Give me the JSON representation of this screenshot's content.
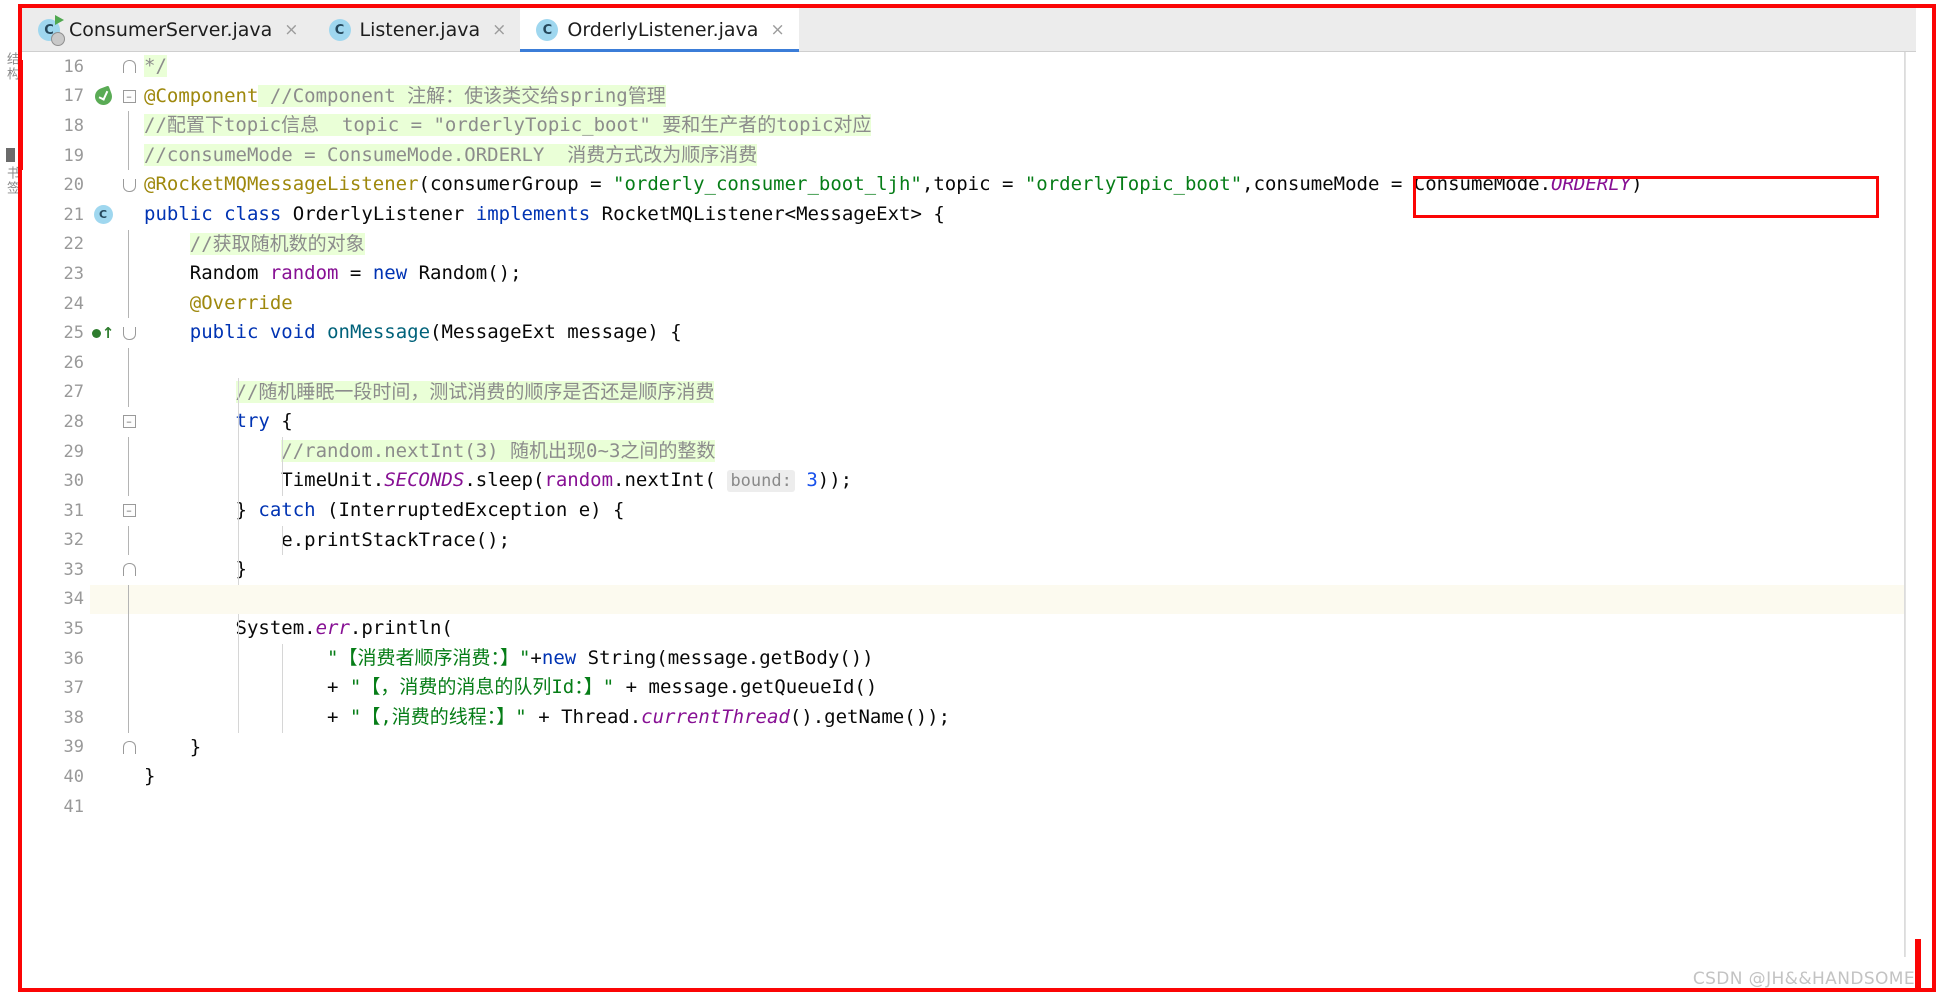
{
  "window": {
    "app": "IntelliJ IDEA Editor",
    "watermark": "CSDN @JH&&HANDSOME"
  },
  "tabs": [
    {
      "label": "ConsumerServer.java",
      "icon": "java-class-run-icon",
      "close": "×",
      "active": false,
      "badge": "C"
    },
    {
      "label": "Listener.java",
      "icon": "java-class-icon",
      "close": "×",
      "active": false,
      "badge": "C"
    },
    {
      "label": "OrderlyListener.java",
      "icon": "java-class-icon",
      "close": "×",
      "active": true,
      "badge": "C"
    }
  ],
  "left_stripe": {
    "labels": [
      "结构",
      "书签"
    ]
  },
  "annotation": {
    "box_color": "#fb0505",
    "frame_color": "#fb0505"
  },
  "editor": {
    "language": "Java",
    "file": "OrderlyListener.java",
    "first_visible_line": 16,
    "last_visible_line": 41,
    "highlighted_line": 34,
    "lines": [
      {
        "num": "16",
        "gutter_icon": "",
        "fold": "",
        "text": "*/"
      },
      {
        "num": "17",
        "gutter_icon": "spring-bean-icon",
        "fold": "fold-collapse",
        "text": "@Component //Component 注解：使该类交给spring管理"
      },
      {
        "num": "18",
        "gutter_icon": "",
        "fold": "",
        "text": "//配置下topic信息  topic = \"orderlyTopic_boot\" 要和生产者的topic对应"
      },
      {
        "num": "19",
        "gutter_icon": "",
        "fold": "",
        "text": "//consumeMode = ConsumeMode.ORDERLY  消费方式改为顺序消费"
      },
      {
        "num": "20",
        "gutter_icon": "",
        "fold": "fold-start",
        "text": "@RocketMQMessageListener(consumerGroup = \"orderly_consumer_boot_ljh\",topic = \"orderlyTopic_boot\",consumeMode = ConsumeMode.ORDERLY)"
      },
      {
        "num": "21",
        "gutter_icon": "java-class-icon",
        "fold": "",
        "text": "public class OrderlyListener implements RocketMQListener<MessageExt> {"
      },
      {
        "num": "22",
        "gutter_icon": "",
        "fold": "",
        "text": "//获取随机数的对象"
      },
      {
        "num": "23",
        "gutter_icon": "",
        "fold": "",
        "text": "Random random = new Random();"
      },
      {
        "num": "24",
        "gutter_icon": "",
        "fold": "",
        "text": "@Override"
      },
      {
        "num": "25",
        "gutter_icon": "override-method-icon",
        "fold": "fold-collapse",
        "text": "public void onMessage(MessageExt message) {"
      },
      {
        "num": "26",
        "gutter_icon": "",
        "fold": "",
        "text": ""
      },
      {
        "num": "27",
        "gutter_icon": "",
        "fold": "",
        "text": "//随机睡眠一段时间，测试消费的顺序是否还是顺序消费"
      },
      {
        "num": "28",
        "gutter_icon": "",
        "fold": "fold-collapse",
        "text": "try {"
      },
      {
        "num": "29",
        "gutter_icon": "",
        "fold": "",
        "text": "//random.nextInt(3) 随机出现0~3之间的整数"
      },
      {
        "num": "30",
        "gutter_icon": "",
        "fold": "",
        "text": "TimeUnit.SECONDS.sleep(random.nextInt( bound: 3));"
      },
      {
        "num": "31",
        "gutter_icon": "",
        "fold": "fold-collapse",
        "text": "} catch (InterruptedException e) {"
      },
      {
        "num": "32",
        "gutter_icon": "",
        "fold": "",
        "text": "e.printStackTrace();"
      },
      {
        "num": "33",
        "gutter_icon": "",
        "fold": "fold-end",
        "text": "}"
      },
      {
        "num": "34",
        "gutter_icon": "",
        "fold": "",
        "text": ""
      },
      {
        "num": "35",
        "gutter_icon": "",
        "fold": "",
        "text": "System.err.println("
      },
      {
        "num": "36",
        "gutter_icon": "",
        "fold": "",
        "text": "\"【消费者顺序消费：】\"+new String(message.getBody())"
      },
      {
        "num": "37",
        "gutter_icon": "",
        "fold": "",
        "text": "+ \"【，消费的消息的队列Id：】\" + message.getQueueId()"
      },
      {
        "num": "38",
        "gutter_icon": "",
        "fold": "",
        "text": "+ \"【,消费的线程：】\" + Thread.currentThread().getName());"
      },
      {
        "num": "39",
        "gutter_icon": "",
        "fold": "fold-end",
        "text": "}"
      },
      {
        "num": "40",
        "gutter_icon": "",
        "fold": "",
        "text": "}"
      },
      {
        "num": "41",
        "gutter_icon": "",
        "fold": "",
        "text": ""
      }
    ]
  },
  "colors": {
    "keyword": "#0033b3",
    "annotation": "#9e880d",
    "comment_text": "#8c8c8c",
    "comment_bg": "#eaffd7",
    "string": "#067d17",
    "static_field": "#871094",
    "method": "#00627a",
    "number": "#1750eb",
    "hint_bg": "#ededed",
    "tab_active_underline": "#3b7dd8",
    "highlight_line_bg": "#fcfaef"
  }
}
